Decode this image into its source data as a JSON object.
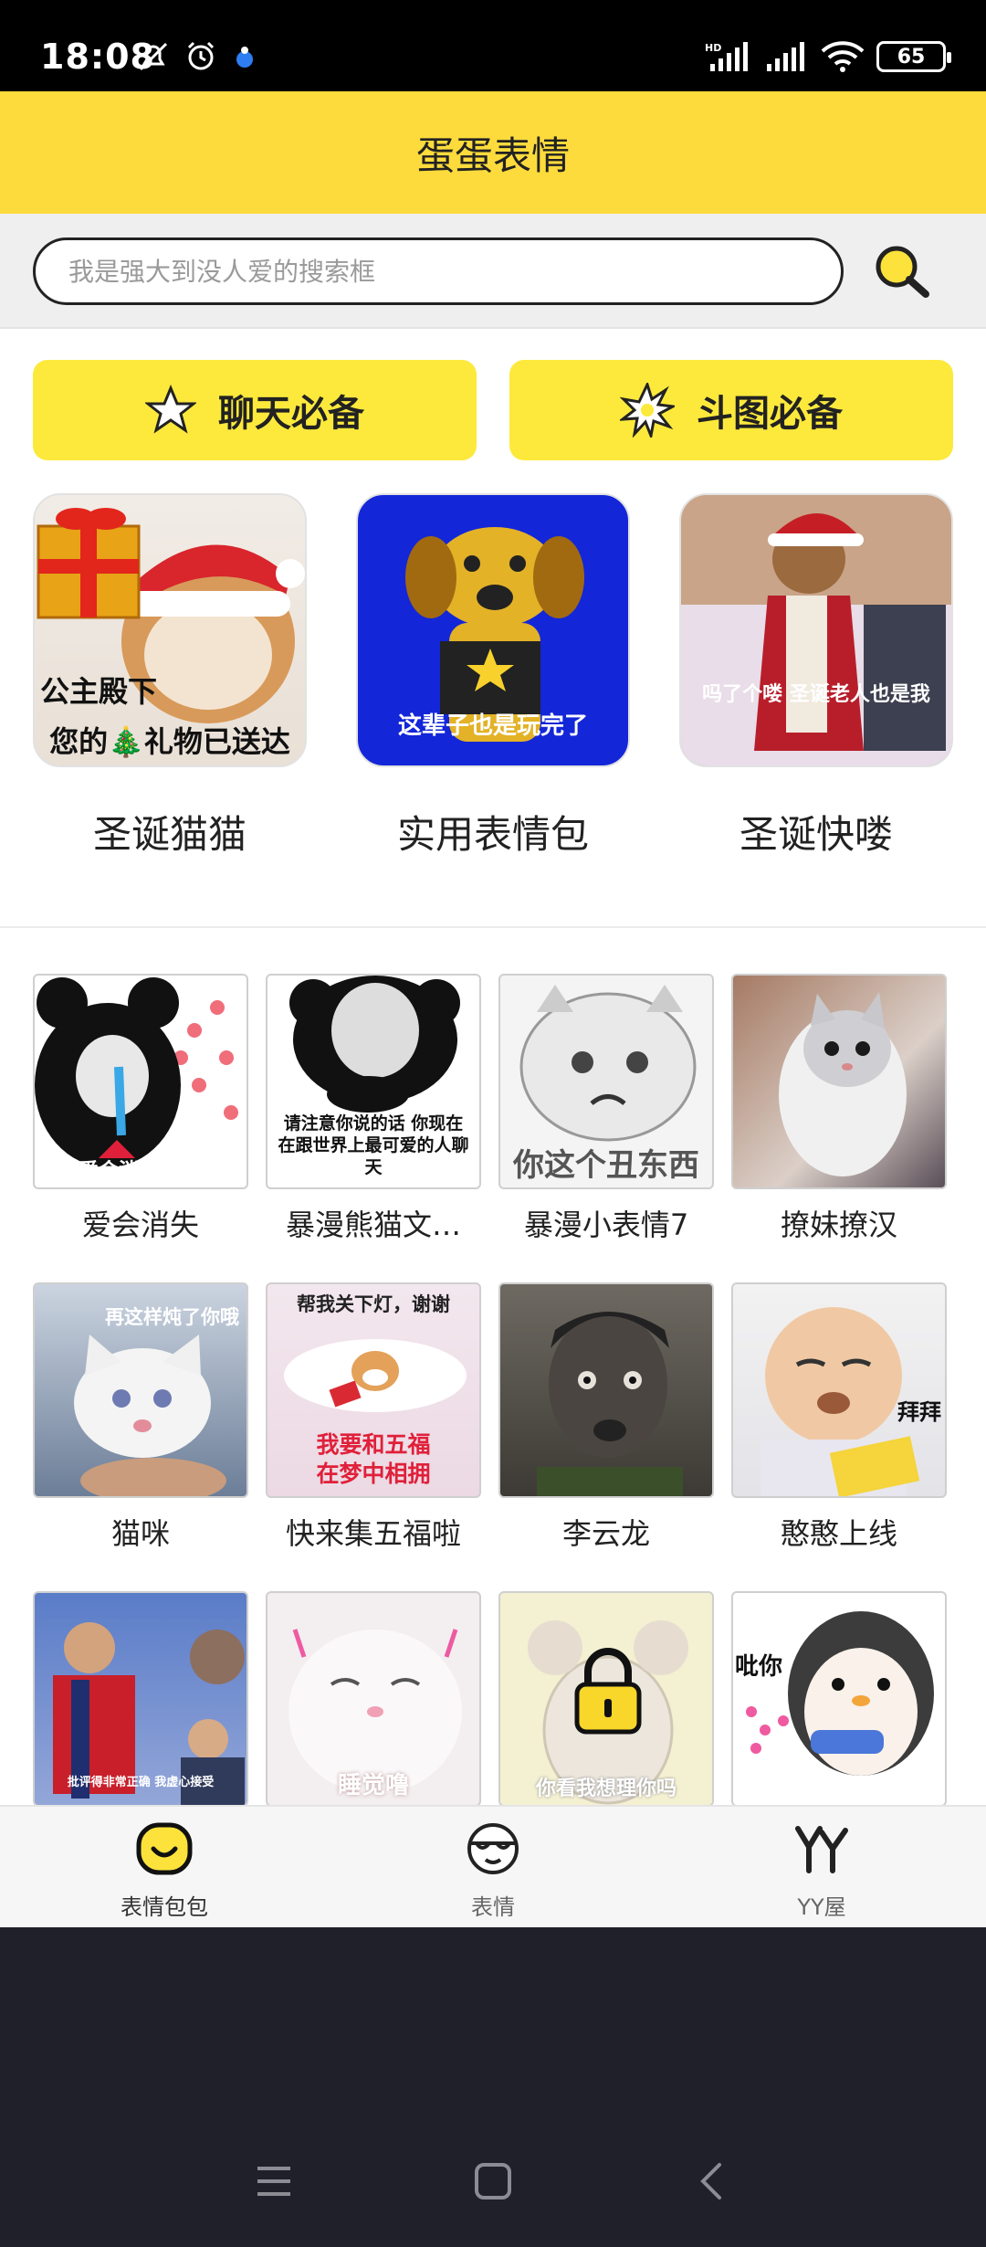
{
  "status_bar": {
    "time": "18:08",
    "battery": "65"
  },
  "header": {
    "title": "蛋蛋表情"
  },
  "search": {
    "placeholder": "我是强大到没人爱的搜索框"
  },
  "categories": [
    {
      "label": "聊天必备",
      "icon": "star-outline-icon"
    },
    {
      "label": "斗图必备",
      "icon": "burst-icon"
    }
  ],
  "featured": [
    {
      "title": "圣诞猫猫",
      "overlay_line1": "公主殿下",
      "overlay_line2": "您的🎄礼物已送达"
    },
    {
      "title": "实用表情包",
      "overlay": "这辈子也是玩完了"
    },
    {
      "title": "圣诞快喽",
      "overlay": "吗了个喽 圣诞老人也是我"
    }
  ],
  "grid": [
    {
      "title": "爱会消失",
      "overlay": "所以爱会消失对吧"
    },
    {
      "title": "暴漫熊猫文…",
      "overlay": "请注意你说的话 你现在在跟世界上最可爱的人聊天"
    },
    {
      "title": "暴漫小表情7",
      "overlay": "你这个丑东西"
    },
    {
      "title": "撩妹撩汉",
      "overlay": ""
    },
    {
      "title": "猫咪",
      "overlay": "再这样炖了你哦"
    },
    {
      "title": "快来集五福啦",
      "overlay_top": "帮我关下灯，谢谢",
      "overlay": "我要和五福 在梦中相拥"
    },
    {
      "title": "李云龙",
      "overlay": ""
    },
    {
      "title": "憨憨上线",
      "overlay": "拜拜"
    },
    {
      "title": "",
      "overlay": "批评得非常正确  我虚心接受"
    },
    {
      "title": "",
      "overlay": "睡觉噜"
    },
    {
      "title": "",
      "overlay": "你看我想理你吗",
      "locked": true
    },
    {
      "title": "",
      "overlay": "吡你"
    }
  ],
  "bottom_nav": [
    {
      "label": "表情包包",
      "icon": "smiley-icon",
      "active": true
    },
    {
      "label": "表情",
      "icon": "face-glasses-icon",
      "active": false
    },
    {
      "label": "YY屋",
      "icon": "yy-logo-icon",
      "active": false
    }
  ],
  "colors": {
    "accent": "#fddb3c",
    "button": "#fde93c"
  }
}
